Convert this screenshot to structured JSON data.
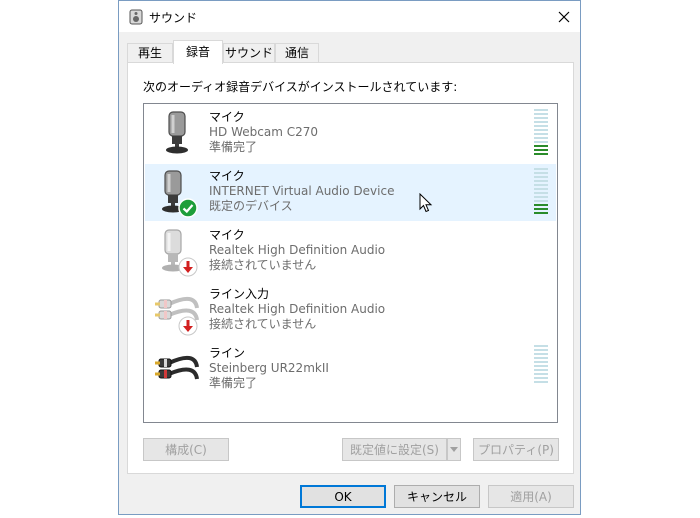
{
  "window": {
    "title": "サウンド",
    "icons": {
      "title": "speaker-icon",
      "close": "close-icon"
    }
  },
  "tabs": [
    {
      "label": "再生",
      "active": false
    },
    {
      "label": "録音",
      "active": true
    },
    {
      "label": "サウンド",
      "active": false
    },
    {
      "label": "通信",
      "active": false
    }
  ],
  "instruction": "次のオーディオ録音デバイスがインストールされています:",
  "devices": [
    {
      "name": "マイク",
      "description": "HD Webcam C270",
      "status": "準備完了",
      "icon": "microphone-icon",
      "selected": false,
      "badge": ""
    },
    {
      "name": "マイク",
      "description": "INTERNET Virtual Audio Device",
      "status": "既定のデバイス",
      "icon": "microphone-icon",
      "selected": true,
      "badge": "default-check-icon"
    },
    {
      "name": "マイク",
      "description": "Realtek High Definition Audio",
      "status": "接続されていません",
      "icon": "microphone-icon",
      "selected": false,
      "badge": "disconnected-arrow-icon"
    },
    {
      "name": "ライン入力",
      "description": "Realtek High Definition Audio",
      "status": "接続されていません",
      "icon": "line-in-cable-icon",
      "selected": false,
      "badge": "disconnected-arrow-icon"
    },
    {
      "name": "ライン",
      "description": "Steinberg UR22mkII",
      "status": "準備完了",
      "icon": "line-cable-icon",
      "selected": false,
      "badge": ""
    }
  ],
  "buttons": {
    "configure": "構成(C)",
    "set_default": "既定値に設定(S)",
    "properties": "プロパティ(P)",
    "ok": "OK",
    "cancel": "キャンセル",
    "apply": "適用(A)"
  },
  "colors": {
    "accent": "#0078d7",
    "selection": "#e5f3ff",
    "level_on": "#2a8c2a",
    "level_off": "#c5dfe6",
    "check_badge": "#1e9e3a",
    "disconnect_badge": "#d21f1f"
  }
}
